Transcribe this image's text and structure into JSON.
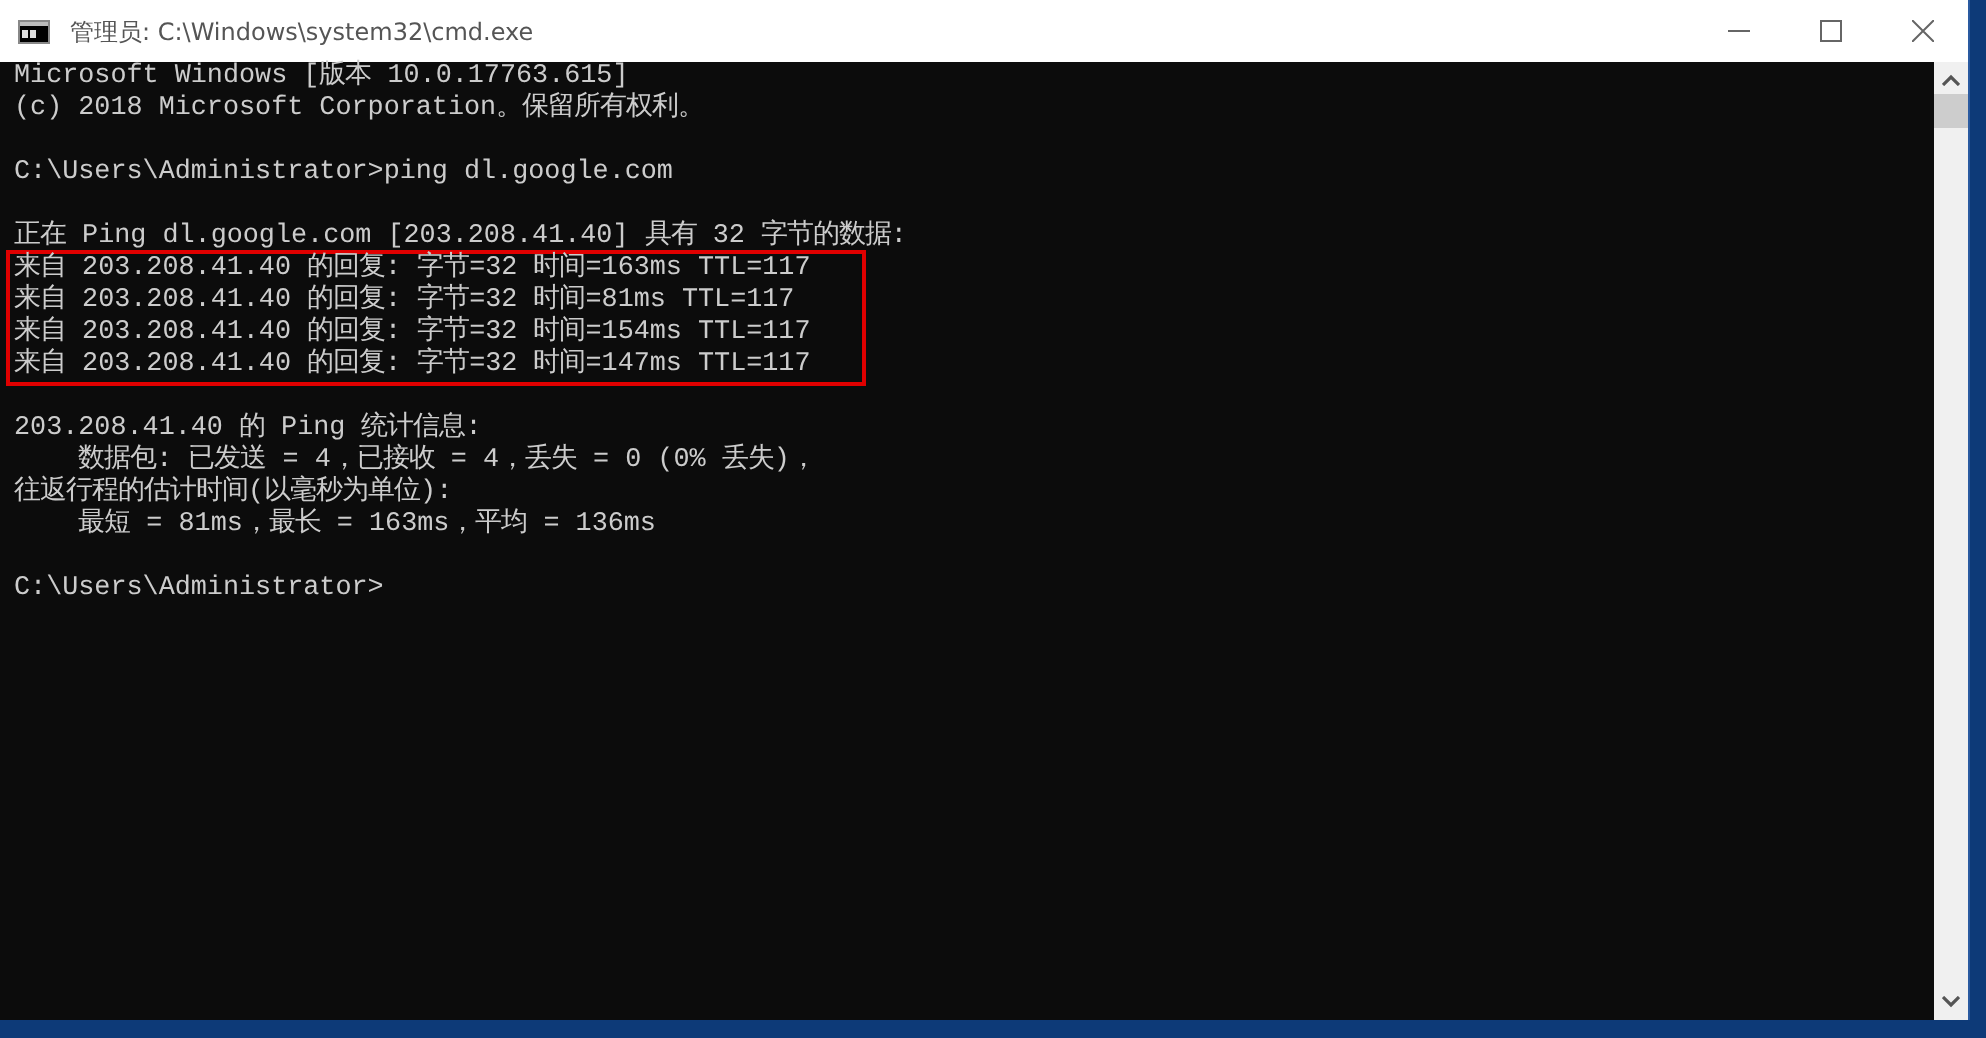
{
  "window": {
    "title": "管理员: C:\\Windows\\system32\\cmd.exe"
  },
  "console": {
    "blocks": [
      {
        "lines": [
          {
            "text": "Microsoft Windows [版本 10.0.17763.615]",
            "highlighted": false
          },
          {
            "text": "(c) 2018 Microsoft Corporation。保留所有权利。",
            "highlighted": false
          }
        ]
      },
      {
        "lines": [
          {
            "text": "C:\\Users\\Administrator>ping dl.google.com",
            "highlighted": false
          }
        ]
      },
      {
        "lines": [
          {
            "text": "正在 Ping dl.google.com [203.208.41.40] 具有 32 字节的数据:",
            "highlighted": false
          },
          {
            "text": "来自 203.208.41.40 的回复: 字节=32 时间=163ms TTL=117",
            "highlighted": true
          },
          {
            "text": "来自 203.208.41.40 的回复: 字节=32 时间=81ms TTL=117",
            "highlighted": true
          },
          {
            "text": "来自 203.208.41.40 的回复: 字节=32 时间=154ms TTL=117",
            "highlighted": true
          },
          {
            "text": "来自 203.208.41.40 的回复: 字节=32 时间=147ms TTL=117",
            "highlighted": true
          }
        ]
      },
      {
        "lines": [
          {
            "text": "203.208.41.40 的 Ping 统计信息:",
            "highlighted": false
          },
          {
            "text": "    数据包: 已发送 = 4，已接收 = 4，丢失 = 0 (0% 丢失)，",
            "highlighted": false
          },
          {
            "text": "往返行程的估计时间(以毫秒为单位):",
            "highlighted": false
          },
          {
            "text": "    最短 = 81ms，最长 = 163ms，平均 = 136ms",
            "highlighted": false
          }
        ]
      },
      {
        "lines": [
          {
            "text": "C:\\Users\\Administrator>",
            "highlighted": false
          }
        ]
      }
    ]
  }
}
